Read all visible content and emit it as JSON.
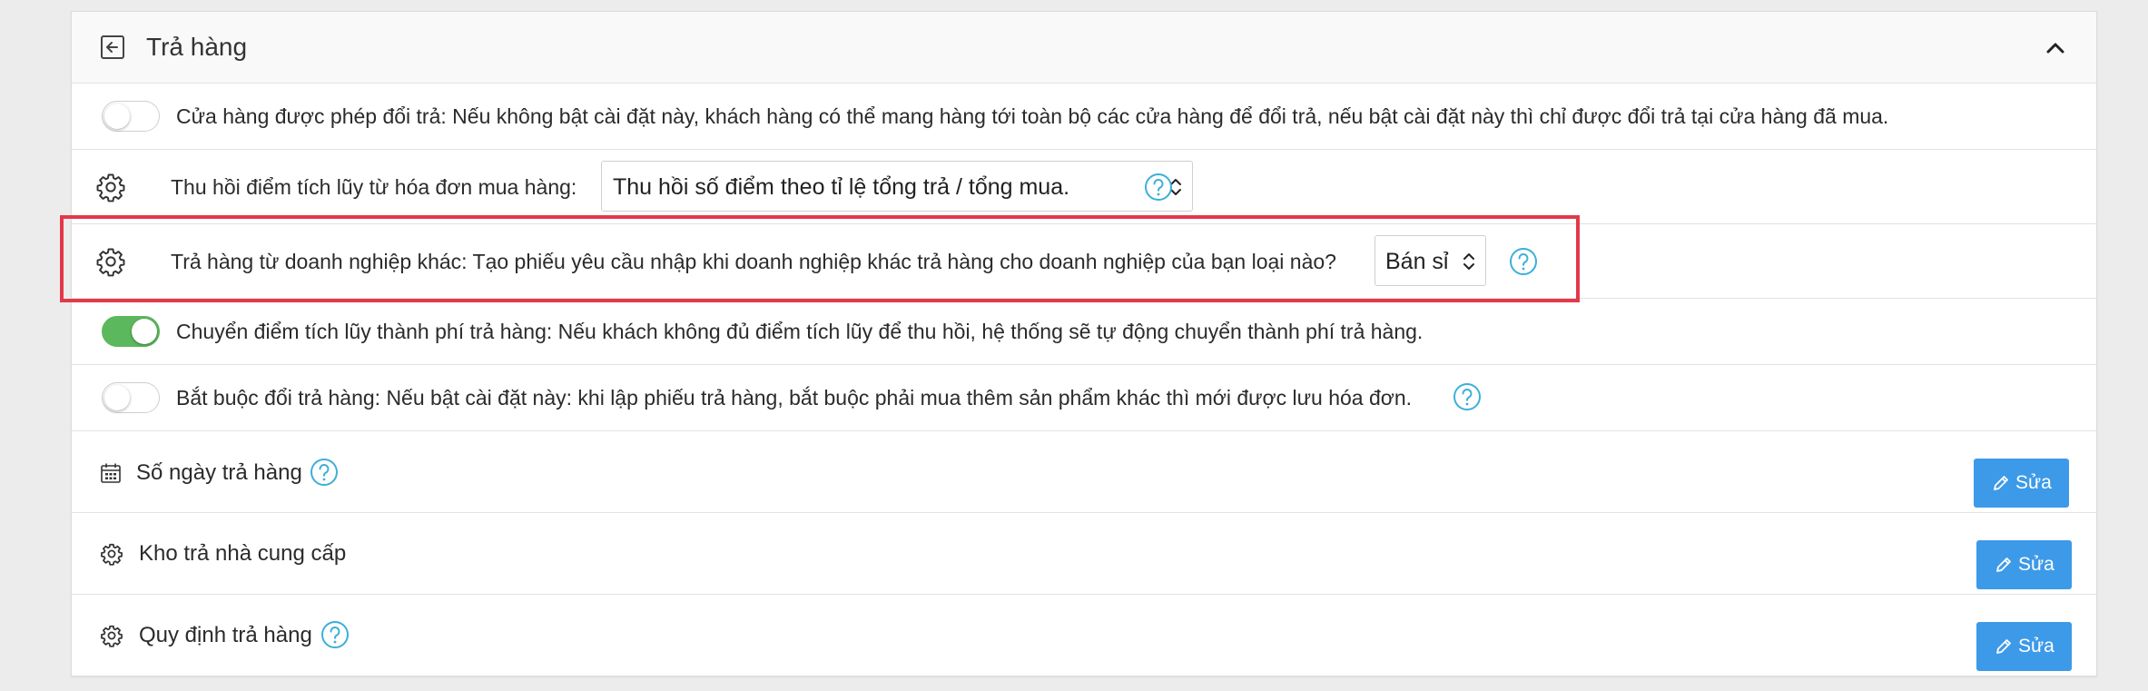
{
  "panel": {
    "title": "Trả hàng",
    "icons": {
      "header": "back-arrow-box-icon",
      "collapse": "chevron-up-icon"
    }
  },
  "settings": [
    {
      "type": "toggle",
      "enabled": false,
      "text": "Cửa hàng được phép đổi trả: Nếu không bật cài đặt này, khách hàng có thể mang hàng tới toàn bộ các cửa hàng để đổi trả, nếu bật cài đặt này thì chỉ được đổi trả tại cửa hàng đã mua."
    },
    {
      "type": "select",
      "icon": "gear-icon",
      "text": "Thu hồi điểm tích lũy từ hóa đơn mua hàng:",
      "selected": "Thu hồi số điểm theo tỉ lệ tổng trả / tổng mua.",
      "has_help": true
    },
    {
      "type": "select",
      "icon": "gear-icon",
      "text": "Trả hàng từ doanh nghiệp khác: Tạo phiếu yêu cầu nhập khi doanh nghiệp khác trả hàng cho doanh nghiệp của bạn loại nào?",
      "selected": "Bán sỉ",
      "has_help": true,
      "highlighted": true
    },
    {
      "type": "toggle",
      "enabled": true,
      "text": "Chuyển điểm tích lũy thành phí trả hàng: Nếu khách không đủ điểm tích lũy để thu hồi, hệ thống sẽ tự động chuyển thành phí trả hàng."
    },
    {
      "type": "toggle",
      "enabled": false,
      "text": "Bắt buộc đổi trả hàng: Nếu bật cài đặt này: khi lập phiếu trả hàng, bắt buộc phải mua thêm sản phẩm khác thì mới được lưu hóa đơn.",
      "has_help": true
    },
    {
      "type": "edit",
      "icon": "calendar-icon",
      "text": "Số ngày trả hàng",
      "has_help": true,
      "button": "Sửa"
    },
    {
      "type": "edit",
      "icon": "gear-icon",
      "text": "Kho trả nhà cung cấp",
      "button": "Sửa"
    },
    {
      "type": "edit",
      "icon": "gear-icon",
      "text": "Quy định trả hàng",
      "has_help": true,
      "button": "Sửa"
    }
  ],
  "colors": {
    "accent": "#3d9ae8",
    "help": "#3bb0d8",
    "toggle_on": "#5cb85c",
    "highlight": "#e2394a"
  }
}
